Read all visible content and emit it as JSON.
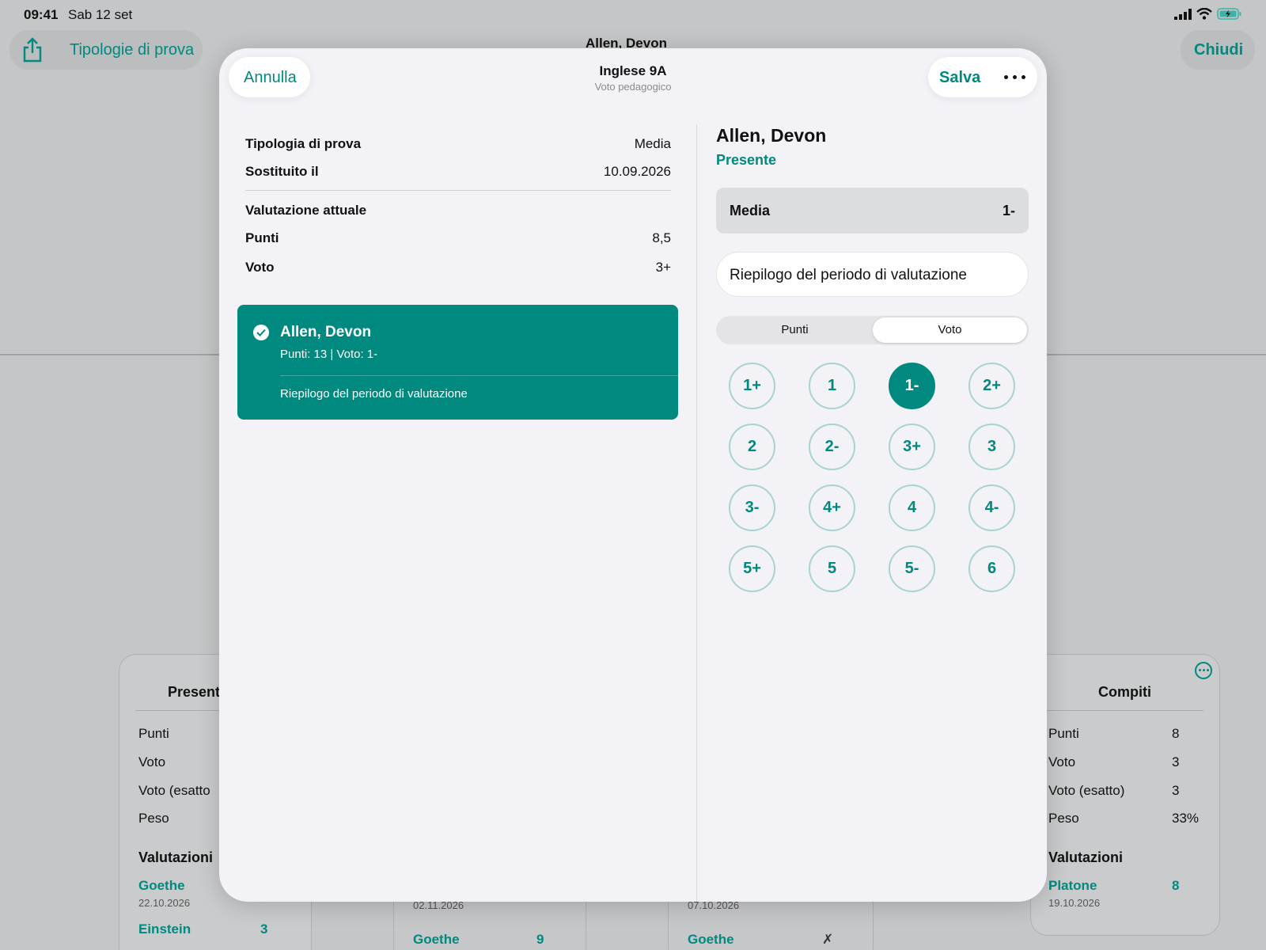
{
  "status_bar": {
    "time": "09:41",
    "date": "Sab 12 set"
  },
  "background": {
    "share_label": "Tipologie di prova",
    "close_label": "Chiudi",
    "title": "Allen, Devon",
    "left_card": {
      "title": "Present",
      "rows": [
        "Punti",
        "Voto",
        "Voto (esatto",
        "Peso"
      ],
      "section": "Valutazioni",
      "entries": [
        {
          "name": "Goethe",
          "date": "22.10.2026",
          "value": ""
        },
        {
          "name": "Einstein",
          "date": "",
          "value": "3"
        }
      ]
    },
    "mid_card_1": {
      "date_top": "02.11.2026",
      "name": "Goethe",
      "value": "9"
    },
    "mid_card_2": {
      "date_top": "07.10.2026",
      "name": "Goethe",
      "value": "✗"
    },
    "right_card": {
      "title": "Compiti",
      "rows": [
        {
          "label": "Punti",
          "value": "8"
        },
        {
          "label": "Voto",
          "value": "3"
        },
        {
          "label": "Voto (esatto)",
          "value": "3"
        },
        {
          "label": "Peso",
          "value": "33%"
        }
      ],
      "section": "Valutazioni",
      "entry": {
        "name": "Platone",
        "date": "19.10.2026",
        "value": "8"
      }
    }
  },
  "modal": {
    "cancel_label": "Annulla",
    "save_label": "Salva",
    "title": "Inglese 9A",
    "subtitle": "Voto pedagogico",
    "left": {
      "test_type_label": "Tipologia di prova",
      "test_type_value": "Media",
      "replaced_label": "Sostituito il",
      "replaced_value": "10.09.2026",
      "current_eval_label": "Valutazione attuale",
      "points_label": "Punti",
      "points_value": "8,5",
      "grade_label": "Voto",
      "grade_value": "3+",
      "student_card": {
        "name": "Allen, Devon",
        "detail": "Punti: 13 | Voto: 1-",
        "summary": "Riepilogo del periodo di valutazione"
      }
    },
    "right": {
      "student_name": "Allen, Devon",
      "attendance": "Presente",
      "grade_type_label": "Media",
      "grade_type_value": "1-",
      "summary_field": "Riepilogo del periodo di valutazione",
      "segments": [
        "Punti",
        "Voto"
      ],
      "selected_segment": "Voto",
      "grades": [
        "1+",
        "1",
        "1-",
        "2+",
        "2",
        "2-",
        "3+",
        "3",
        "3-",
        "4+",
        "4",
        "4-",
        "5+",
        "5",
        "5-",
        "6"
      ],
      "selected_grade": "1-"
    }
  },
  "colors": {
    "accent": "#00897e",
    "selected_ring": "#a9d3d0"
  }
}
